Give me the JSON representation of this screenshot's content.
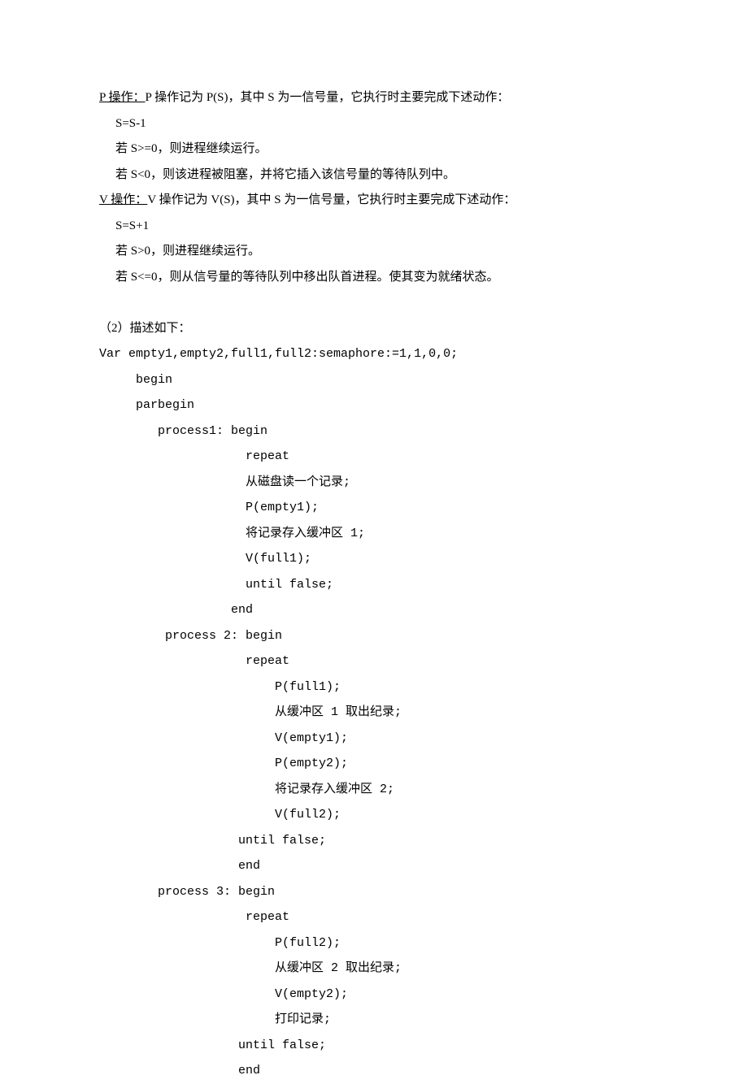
{
  "section1": {
    "p_op_title": "P 操作：",
    "p_op_desc": "P 操作记为 P(S)，其中 S 为一信号量，它执行时主要完成下述动作：",
    "p_line1": "S=S-1",
    "p_line2": "若 S>=0，则进程继续运行。",
    "p_line3": "若 S<0，则该进程被阻塞，并将它插入该信号量的等待队列中。",
    "v_op_title": "V 操作：",
    "v_op_desc": "V 操作记为 V(S)，其中 S 为一信号量，它执行时主要完成下述动作：",
    "v_line1": "S=S+1",
    "v_line2": "若 S>0，则进程继续运行。",
    "v_line3": "若 S<=0，则从信号量的等待队列中移出队首进程。使其变为就绪状态。"
  },
  "section2": {
    "heading": "（2）描述如下：",
    "code": {
      "l01": "Var empty1,empty2,full1,full2:semaphore:=1,1,0,0;",
      "l02": "     begin",
      "l03": "     parbegin",
      "l04": "        process1: begin",
      "l05": "                    repeat",
      "l06": "                    从磁盘读一个记录;",
      "l07": "                    P(empty1);",
      "l08": "                    将记录存入缓冲区 1;",
      "l09": "                    V(full1);",
      "l10": "                    until false;",
      "l11": "                  end",
      "l12": "         process 2: begin",
      "l13": "                    repeat",
      "l14": "                        P(full1);",
      "l15": "                        从缓冲区 1 取出纪录;",
      "l16": "                        V(empty1);",
      "l17": "                        P(empty2);",
      "l18": "                        将记录存入缓冲区 2;",
      "l19": "                        V(full2);",
      "l20": "                   until false;",
      "l21": "                   end",
      "l22": "        process 3: begin",
      "l23": "                    repeat",
      "l24": "                        P(full2);",
      "l25": "                        从缓冲区 2 取出纪录;",
      "l26": "                        V(empty2);",
      "l27": "                        打印记录;",
      "l28": "                   until false;",
      "l29": "                   end"
    }
  }
}
